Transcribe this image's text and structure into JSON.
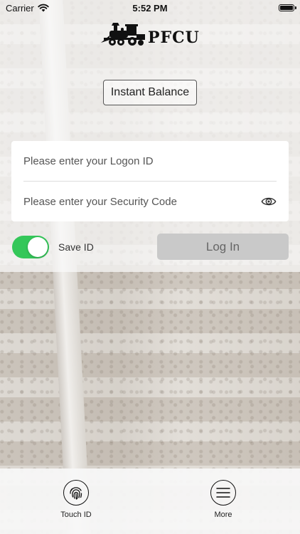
{
  "status_bar": {
    "carrier": "Carrier",
    "time": "5:52 PM"
  },
  "logo": {
    "text": "PFCU"
  },
  "instant_balance": {
    "label": "Instant Balance"
  },
  "form": {
    "logon_placeholder": "Please enter your Logon ID",
    "logon_value": "",
    "security_placeholder": "Please enter your Security Code",
    "security_value": ""
  },
  "save_id": {
    "label": "Save ID",
    "on": true
  },
  "login_button": {
    "label": "Log In"
  },
  "tab_bar": {
    "touch_id": {
      "label": "Touch ID",
      "icon": "fingerprint-icon"
    },
    "more": {
      "label": "More",
      "icon": "menu-icon"
    }
  },
  "colors": {
    "toggle_on": "#34c759",
    "login_disabled": "#c9c9c9"
  }
}
